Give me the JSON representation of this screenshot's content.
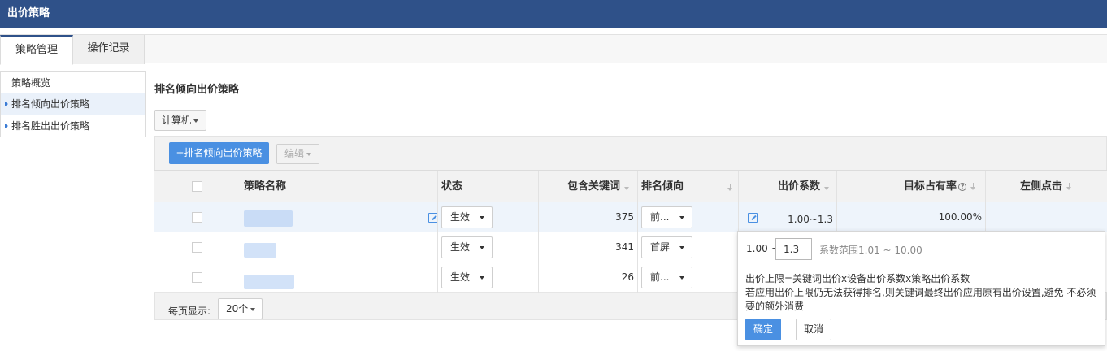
{
  "header": {
    "title": "出价策略"
  },
  "tabs": [
    {
      "label": "策略管理"
    },
    {
      "label": "操作记录"
    }
  ],
  "sidebar": {
    "items": [
      {
        "label": "策略概览"
      },
      {
        "label": "排名倾向出价策略"
      },
      {
        "label": "排名胜出出价策略"
      }
    ]
  },
  "main": {
    "section_title": "排名倾向出价策略",
    "device_select": "计算机",
    "add_button": "+排名倾向出价策略",
    "edit_button": "编辑"
  },
  "table": {
    "columns": [
      "策略名称",
      "状态",
      "包含关键词",
      "排名倾向",
      "出价系数",
      "目标占有率",
      "左侧点击"
    ],
    "rows": [
      {
        "status": "生效",
        "keywords": "375",
        "tendency": "前...",
        "coefficient": "1.00~1.3",
        "target_share": "100.00%"
      },
      {
        "status": "生效",
        "keywords": "341",
        "tendency": "首屏"
      },
      {
        "status": "生效",
        "keywords": "26",
        "tendency": "前..."
      }
    ]
  },
  "pager": {
    "label": "每页显示:",
    "page_size": "20个"
  },
  "popover": {
    "range_prefix": "1.00 ~",
    "input_value": "1.3",
    "range_hint": "系数范围1.01 ~ 10.00",
    "line1": "出价上限=关键词出价x设备出价系数x策略出价系数",
    "line2": "若应用出价上限仍无法获得排名,则关键词最终出价应用原有出价设置,避免 不必须",
    "line3": "要的额外消费",
    "ok_label": "确定",
    "cancel_label": "取消"
  },
  "colors": {
    "header_bg": "#2f5189",
    "accent": "#4a90e2"
  }
}
